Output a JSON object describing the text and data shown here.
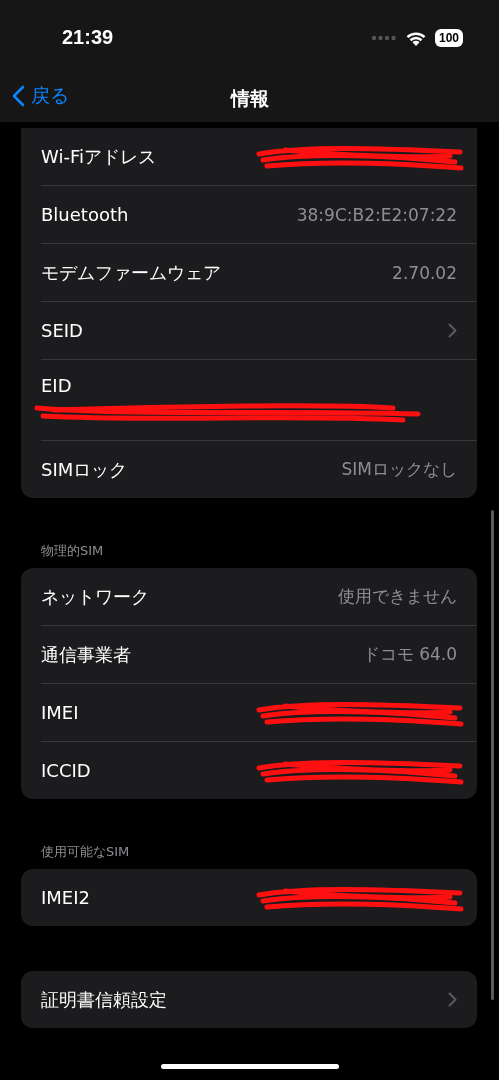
{
  "status_bar": {
    "time": "21:39",
    "battery": "100"
  },
  "nav": {
    "back": "戻る",
    "title": "情報"
  },
  "groups": [
    {
      "rows": [
        {
          "kind": "redacted",
          "label": "Wi-Fiアドレス"
        },
        {
          "kind": "value",
          "label": "Bluetooth",
          "value": "38:9C:B2:E2:07:22"
        },
        {
          "kind": "value",
          "label": "モデムファームウェア",
          "value": "2.70.02"
        },
        {
          "kind": "chevron",
          "label": "SEID"
        },
        {
          "kind": "stacked_redacted",
          "label": "EID"
        },
        {
          "kind": "value",
          "label": "SIMロック",
          "value": "SIMロックなし"
        }
      ]
    },
    {
      "header": "物理的SIM",
      "rows": [
        {
          "kind": "value",
          "label": "ネットワーク",
          "value": "使用できません"
        },
        {
          "kind": "value",
          "label": "通信事業者",
          "value": "ドコモ 64.0"
        },
        {
          "kind": "redacted",
          "label": "IMEI"
        },
        {
          "kind": "redacted",
          "label": "ICCID"
        }
      ]
    },
    {
      "header": "使用可能なSIM",
      "rows": [
        {
          "kind": "redacted",
          "label": "IMEI2"
        }
      ]
    },
    {
      "rows": [
        {
          "kind": "chevron",
          "label": "証明書信頼設定"
        }
      ]
    }
  ]
}
